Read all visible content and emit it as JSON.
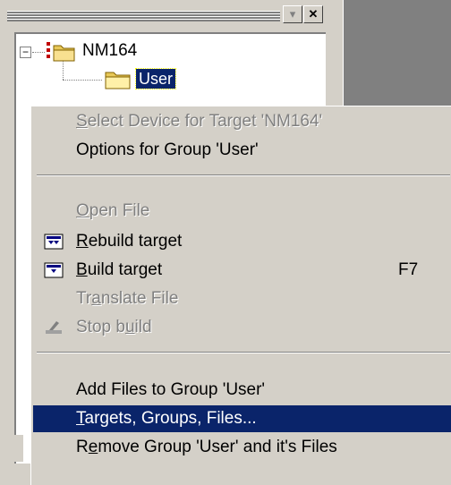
{
  "panel": {
    "tree": {
      "root_label": "NM164",
      "child_label": "User"
    },
    "buttons": {
      "pin_glyph": "▾",
      "close_glyph": "✕"
    }
  },
  "context_menu": {
    "items": [
      {
        "pre": "",
        "key": "S",
        "post": "elect Device for Target 'NM164'",
        "enabled": false
      },
      {
        "pre": "Options for Group 'User'",
        "key": "",
        "post": "",
        "enabled": true
      },
      {
        "pre": "",
        "key": "O",
        "post": "pen File",
        "enabled": false
      },
      {
        "pre": "",
        "key": "R",
        "post": "ebuild target",
        "enabled": true,
        "icon": "rebuild-icon"
      },
      {
        "pre": "",
        "key": "B",
        "post": "uild target",
        "enabled": true,
        "icon": "build-icon",
        "shortcut": "F7"
      },
      {
        "pre": "Tr",
        "key": "a",
        "post": "nslate File",
        "enabled": false
      },
      {
        "pre": "Stop b",
        "key": "u",
        "post": "ild",
        "enabled": false,
        "icon": "stop-build-icon"
      },
      {
        "pre": "Add Files to Group 'User'",
        "key": "",
        "post": "",
        "enabled": true
      },
      {
        "pre": "",
        "key": "T",
        "post": "argets, Groups, Files...",
        "enabled": true,
        "highlighted": true
      },
      {
        "pre": "R",
        "key": "e",
        "post": "move Group 'User' and it's Files",
        "enabled": true
      }
    ]
  },
  "colors": {
    "highlight": "#0a246a",
    "face": "#d4d0c8",
    "workspace": "#808080"
  }
}
